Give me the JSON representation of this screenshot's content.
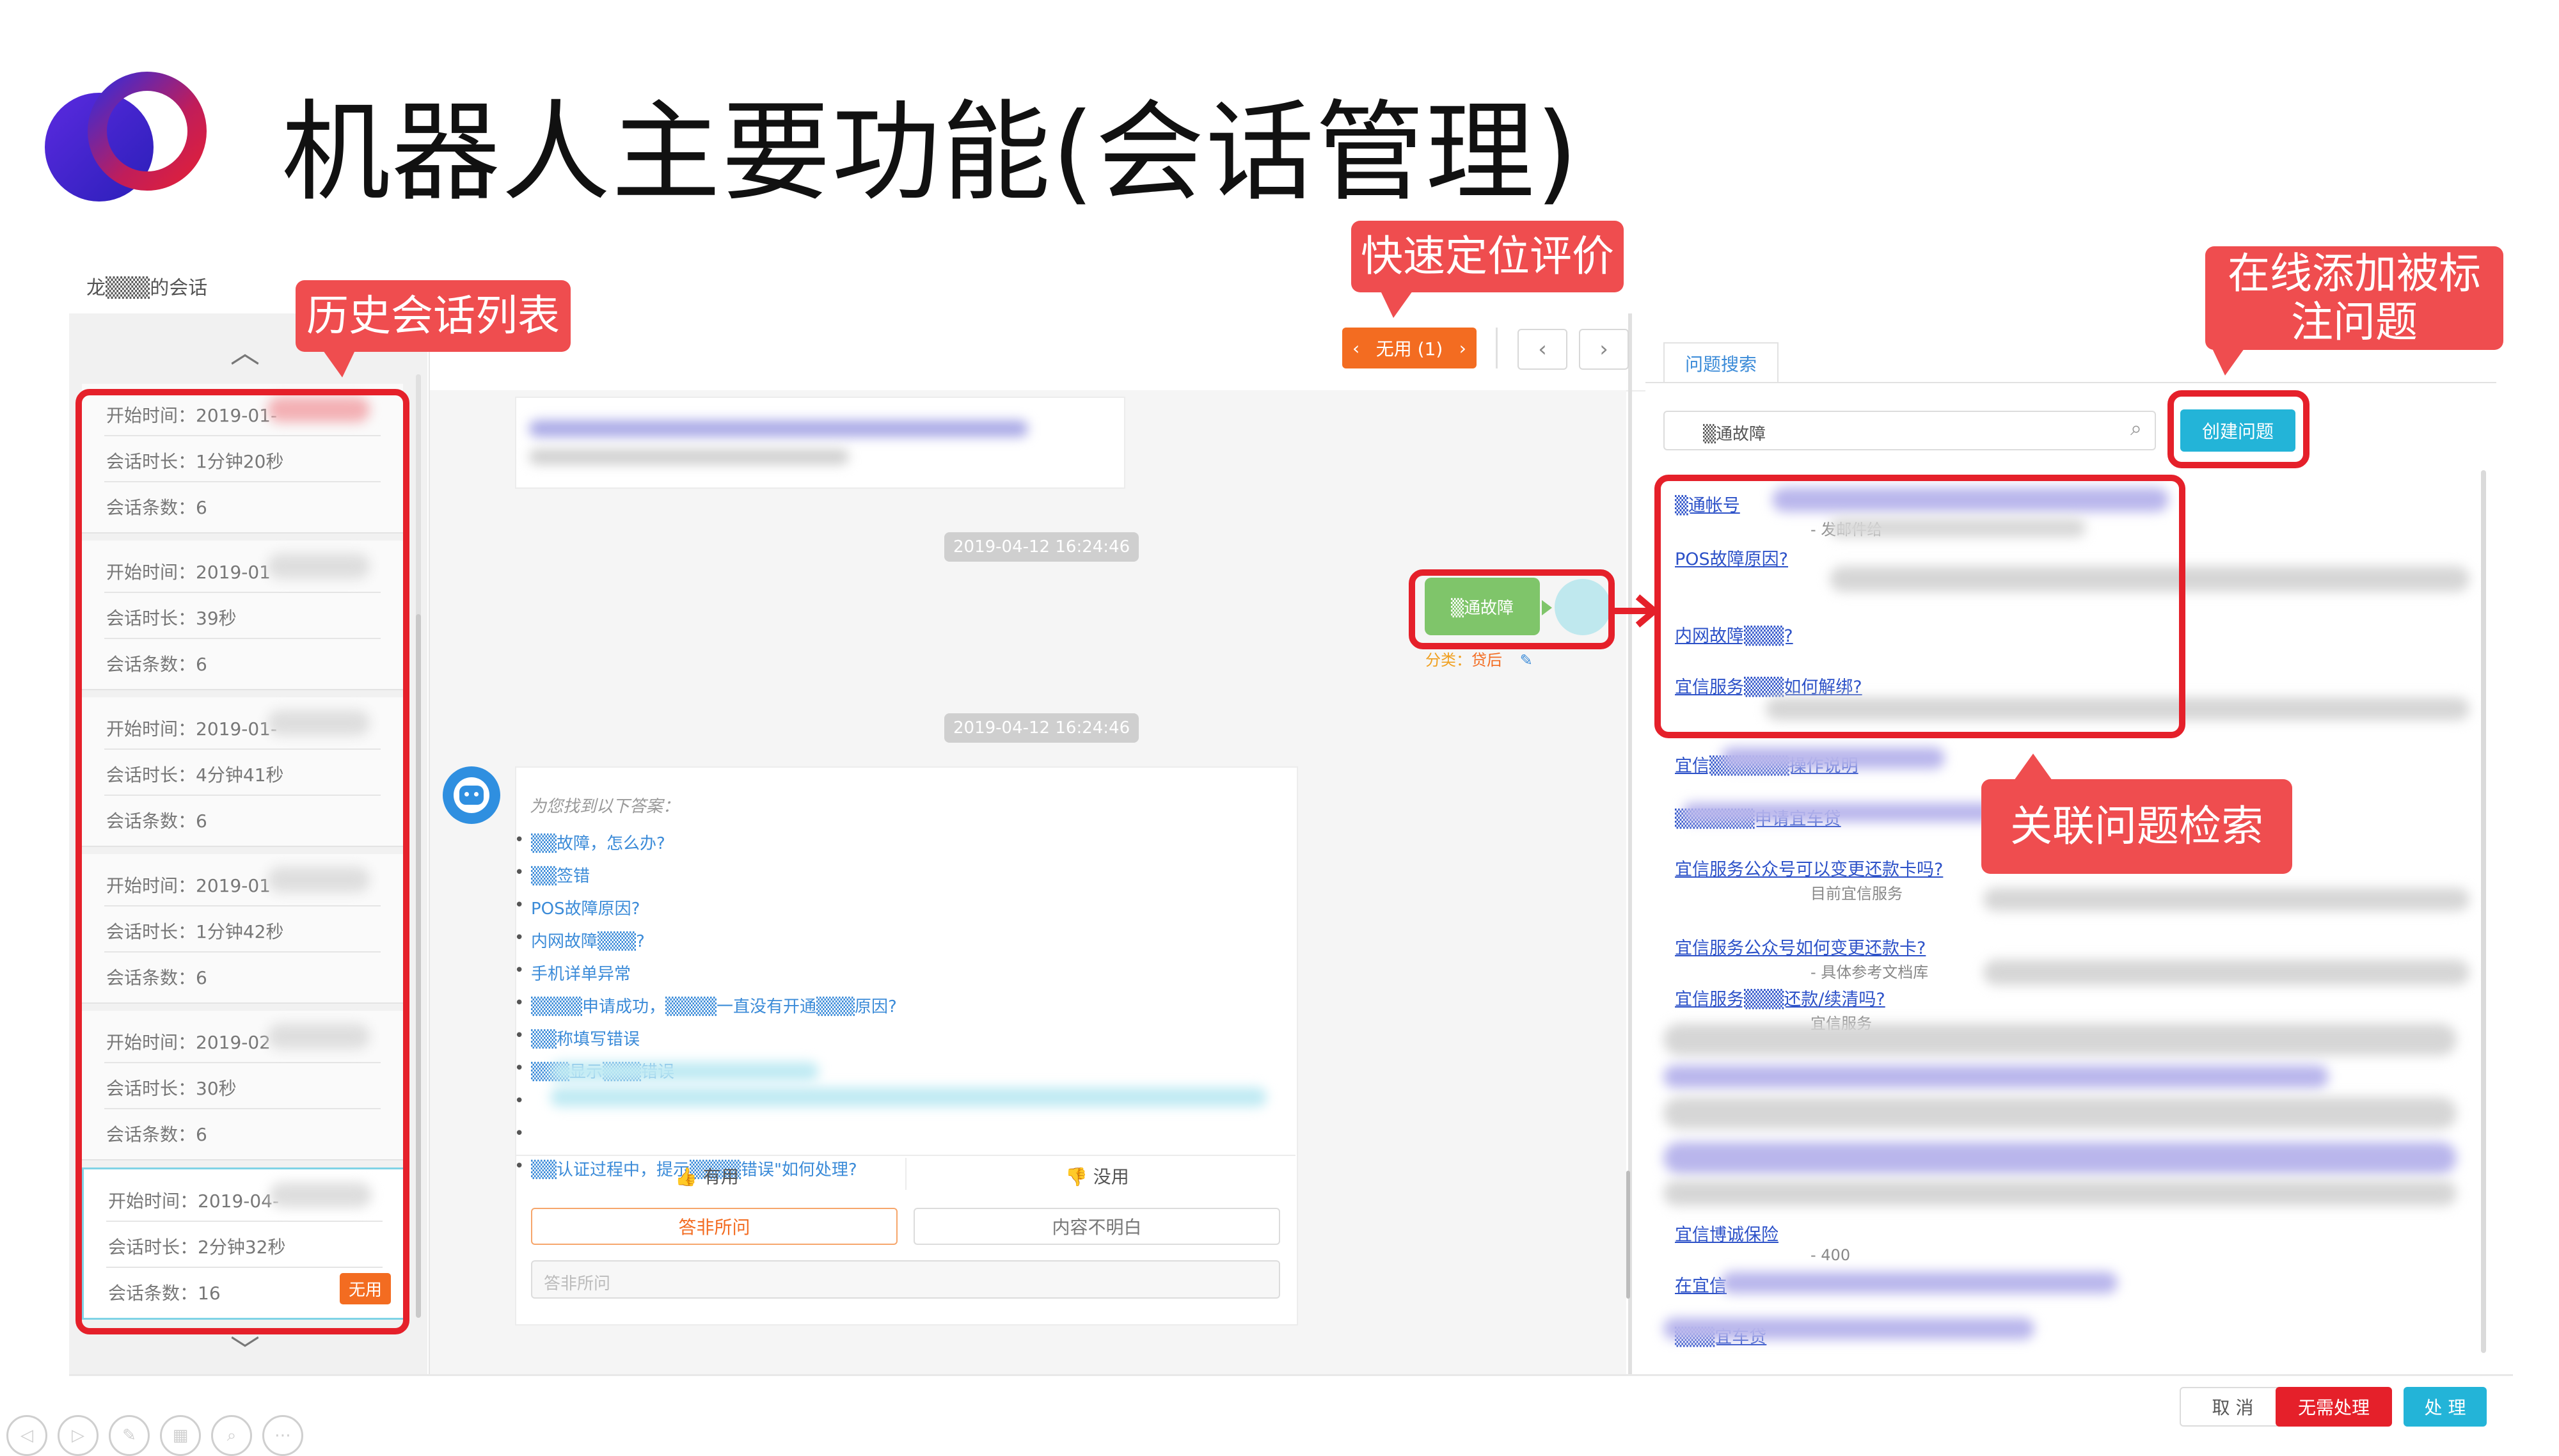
{
  "slide": {
    "title": "机器人主要功能(会话管理)"
  },
  "session_header": {
    "title": "龙▒▒▒的会话"
  },
  "callouts": {
    "history": "历史会话列表",
    "locate": "快速定位评价",
    "add_question": "在线添加被标注问题",
    "related": "关联问题检索"
  },
  "history": {
    "sessions": [
      {
        "start": "开始时间：2019-01-",
        "duration": "会话时长：1分钟20秒",
        "count": "会话条数：6"
      },
      {
        "start": "开始时间：2019-01",
        "duration": "会话时长：39秒",
        "count": "会话条数：6"
      },
      {
        "start": "开始时间：2019-01-",
        "duration": "会话时长：4分钟41秒",
        "count": "会话条数：6"
      },
      {
        "start": "开始时间：2019-01",
        "duration": "会话时长：1分钟42秒",
        "count": "会话条数：6"
      },
      {
        "start": "开始时间：2019-02",
        "duration": "会话时长：30秒",
        "count": "会话条数：6"
      },
      {
        "start": "开始时间：2019-04-",
        "duration": "会话时长：2分钟32秒",
        "count": "会话条数：16",
        "badge": "无用"
      }
    ]
  },
  "toolbar": {
    "filter_label": "无用 (1)"
  },
  "chat": {
    "timestamp_1": "2019-04-12 16:24:46",
    "timestamp_2": "2019-04-12 16:24:46",
    "user_msg": "▒通故障",
    "category_label": "分类：",
    "category_value": "贷后",
    "answer_intro": "为您找到以下答案：",
    "answers": [
      "▒▒故障，怎么办?",
      "▒▒签错",
      "POS故障原因?",
      "内网故障▒▒▒?",
      "手机详单异常",
      "▒▒▒▒申请成功，▒▒▒▒一直没有开通▒▒▒原因?",
      "▒▒称填写错误",
      "▒▒▒显示▒▒▒错误",
      "",
      "",
      "▒▒认证过程中，提示▒▒▒▒错误\"如何处理?"
    ],
    "useful_label": "有用",
    "useless_label": "没用",
    "option_1": "答非所问",
    "option_2": "内容不明白",
    "input_placeholder": "答非所问"
  },
  "right_panel": {
    "tab": "问题搜索",
    "search_value": "▒通故障",
    "create_button": "创建问题",
    "results": [
      {
        "title": "▒通帐号",
        "sub": "- 发邮件给"
      },
      {
        "title": "POS故障原因?",
        "sub": ""
      },
      {
        "title": "内网故障▒▒▒?",
        "sub": ""
      },
      {
        "title": "宜信服务▒▒▒如何解绑?",
        "sub": ""
      },
      {
        "title": "宜信▒▒▒▒▒▒操作说明",
        "sub": ""
      },
      {
        "title": "▒▒▒▒▒▒申请宜车贷",
        "sub": ""
      },
      {
        "title": "宜信服务公众号可以变更还款卡吗?",
        "sub": "目前宜信服务"
      },
      {
        "title": "宜信服务公众号如何变更还款卡?",
        "sub": "- 具体参考文档库"
      },
      {
        "title": "宜信服务▒▒▒还款/续清吗?",
        "sub": "宜信服务"
      },
      {
        "title": "宜信博诚保险",
        "sub": "- 400"
      },
      {
        "title": "在宜信",
        "sub": ""
      },
      {
        "title": "▒▒▒宜车贷",
        "sub": ""
      }
    ]
  },
  "footer_buttons": {
    "cancel": "取 消",
    "no_process": "无需处理",
    "process": "处 理"
  },
  "colors": {
    "accent_red": "#e5202a",
    "callout_red": "#ef4d4f",
    "orange": "#f36c21",
    "teal": "#23b4d8",
    "green": "#7fc56a",
    "link_blue": "#2c51c8"
  }
}
